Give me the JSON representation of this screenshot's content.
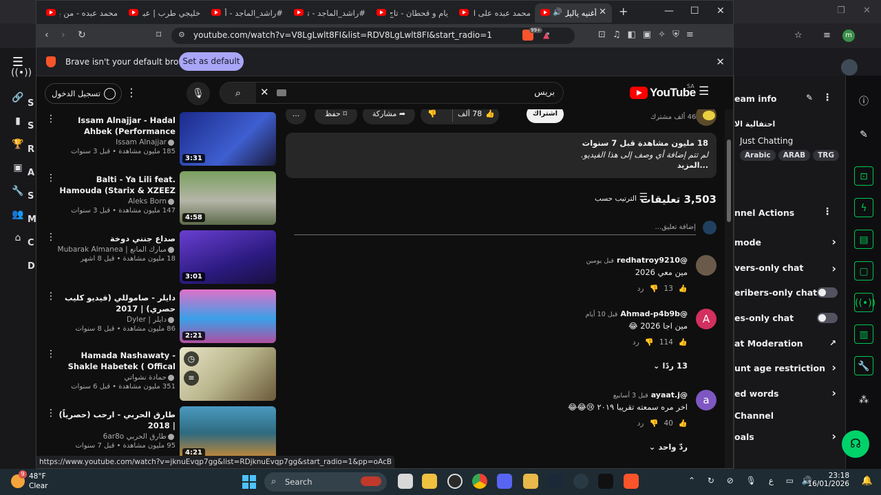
{
  "browser": {
    "tabs": [
      {
        "title": "محمد عبده - من بالي",
        "active": false
      },
      {
        "title": "خليجي طرب | عبنة",
        "active": false
      },
      {
        "title": "#راشد_الماجد - أحبك",
        "active": false
      },
      {
        "title": "#راشد_الماجد - تحبك",
        "active": false
      },
      {
        "title": "يام و قحطان - تاج",
        "active": false
      },
      {
        "title": "محمد عبده على الأمر",
        "active": false
      },
      {
        "title": "أغنيه ياليل",
        "active": true
      }
    ],
    "url": "youtube.com/watch?v=V8LgLwlt8FI&list=RDV8LgLwlt8FI&start_radio=1",
    "shields_count": "99+",
    "infobar_text": "Brave isn't your default browser",
    "set_default_label": "Set as default",
    "status_url": "https://www.youtube.com/watch?v=jknuEvqp7gg&list=RDjknuEvqp7gg&start_radio=1&pp=oAcB"
  },
  "youtube": {
    "signin_label": "تسجيل الدخول",
    "search_query": "بريس",
    "logo_text": "YouTube",
    "region": "SA",
    "related": [
      {
        "title": "Issam Alnajjar - Hadal Ahbek (Performance Video)",
        "channel": "Issam Alnajjar",
        "meta": "185 مليون مشاهدة • قبل 3 سنوات",
        "duration": "3:31",
        "thumb": "#2a3fae"
      },
      {
        "title": "Balti - Ya Lili feat. Hamouda (Starix & XZEEZ ...",
        "channel": "Aleks Born",
        "meta": "147 مليون مشاهدة • قبل 3 سنوات",
        "duration": "4:58",
        "thumb": "#6b8c5a"
      },
      {
        "title": "صداع جنني دوخة",
        "channel": "مبارك المانع | Mubarak Almanea",
        "meta": "18 مليون مشاهدة • قبل 8 أشهر",
        "duration": "3:01",
        "thumb": "#4b2e9e"
      },
      {
        "title": "دايلر - صاموللي (فيديو كليب حصري) | 2017",
        "channel": "دايلر | Dyler",
        "meta": "86 مليون مشاهدة • قبل 8 سنوات",
        "duration": "2:21",
        "thumb": "#c85aa8"
      },
      {
        "title": "Hamada Nashawaty - Shakle Habetek ( Offical Music Video)...",
        "channel": "حمادة نشواتي",
        "meta": "351 مليون مشاهدة • قبل 6 سنوات",
        "duration": "",
        "thumb": "#8a8f60"
      },
      {
        "title": "طارق الحربي - ارحب (حصرياً) | 2018",
        "channel": "طارق الحربي 6ar8o",
        "meta": "95 مليون مشاهدة • قبل 7 سنوات",
        "duration": "4:21",
        "thumb": "#3c7a9a"
      }
    ],
    "actions": {
      "more": "...",
      "save": "حفظ",
      "share": "مشاركة",
      "likes": "78 ألف",
      "subscribe": "اشتراك",
      "subscribers": "46 ألف مشترك"
    },
    "description": {
      "stats": "18 مليون مشاهدة  قبل 7 سنوات",
      "text": "لم تتم إضافة أي وصف إلى هذا الفيديو.",
      "more": "...المزيد"
    },
    "comments_count": "3,503 تعليقات",
    "sort_label": "الترتيب حسب",
    "add_comment_placeholder": "إضافة تعليق...",
    "comments": [
      {
        "author": "@redhatroy9210",
        "time": "قبل يومين",
        "text": "مين معي 2026",
        "likes": "13",
        "reply": "رد",
        "avatar_letter": "",
        "avatar_color": "#6a5a4a",
        "replies": ""
      },
      {
        "author": "@Ahmad-p4b9b",
        "time": "قبل 10 أيام",
        "text": "مين اجا 2026 😂",
        "likes": "114",
        "reply": "رد",
        "avatar_letter": "A",
        "avatar_color": "#d32f5f",
        "replies": "13 ردًا"
      },
      {
        "author": "@ayaat.j",
        "time": "قبل 3 أسابيع",
        "text": "اخر مره سمعته تقريبا ٢٠١٩ 😢😂😂",
        "likes": "40",
        "reply": "رد",
        "avatar_letter": "a",
        "avatar_color": "#7e57c2",
        "replies": "ردّ واحد"
      }
    ]
  },
  "twitch": {
    "stream_info": "eam info",
    "title_partial": "احتفالية الا",
    "category": "Just Chatting",
    "tags": [
      "Arabic",
      "ARAB",
      "TRG"
    ],
    "channel_actions": "nnel Actions",
    "rows": [
      {
        "label": "mode",
        "control": "chevron"
      },
      {
        "label": "vers-only chat",
        "control": "chevron"
      },
      {
        "label": "eribers-only chat",
        "control": "toggle"
      },
      {
        "label": "es-only chat",
        "control": "toggle"
      },
      {
        "label": "at Moderation",
        "control": "external"
      },
      {
        "label": "unt age restriction",
        "control": "chevron"
      },
      {
        "label": "ed words",
        "control": "chevron"
      },
      {
        "label": "Channel",
        "control": "none"
      },
      {
        "label": "oals",
        "control": "chevron"
      }
    ]
  },
  "outer_rail_letters": [
    "S",
    "S",
    "R",
    "A",
    "S",
    "M",
    "C",
    "D"
  ],
  "taskbar": {
    "weather_temp": "48°F",
    "weather_desc": "Clear",
    "weather_badge": "9",
    "search_label": "Search",
    "time": "23:18",
    "date": "16/01/2026",
    "lang": "ع"
  }
}
